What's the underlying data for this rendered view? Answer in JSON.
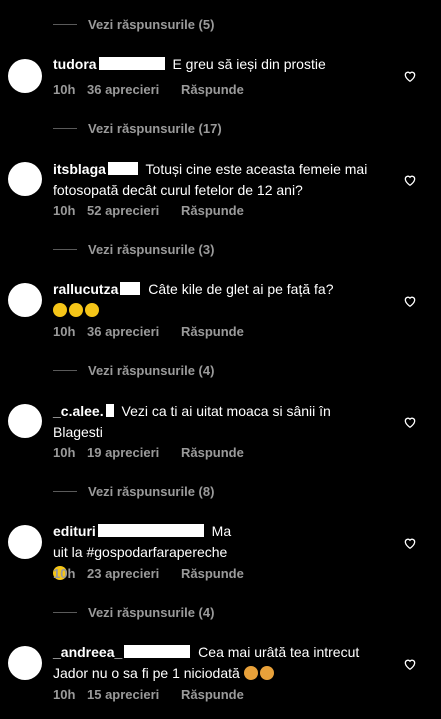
{
  "comments": [
    {
      "username": "tudora",
      "redact_w": 66,
      "text": "E greu să ieși din prostie",
      "time": "10h",
      "likes": "36 aprecieri",
      "reply": "Răspunde",
      "replies_label": "Vezi răspunsurile (17)"
    },
    {
      "username": "itsblaga",
      "redact_w": 30,
      "text": "Totuși cine este aceasta femeie mai fotosopată decât curul fetelor de 12 ani?",
      "time": "10h",
      "likes": "52 aprecieri",
      "reply": "Răspunde",
      "replies_label": "Vezi răspunsurile (3)"
    },
    {
      "username": "rallucutza",
      "redact_w": 20,
      "text": "Câte kile de glet ai pe față fa?",
      "emojis": [
        "laughing-tears",
        "laughing-tears",
        "laughing-tears"
      ],
      "time": "10h",
      "likes": "36 aprecieri",
      "reply": "Răspunde",
      "replies_label": "Vezi răspunsurile (4)"
    },
    {
      "username": "_c.alee.",
      "redact_w": 8,
      "text": "Vezi ca ti ai uitat moaca si sânii în Blagesti",
      "time": "10h",
      "likes": "19 aprecieri",
      "reply": "Răspunde",
      "replies_label": "Vezi răspunsurile (8)"
    },
    {
      "username": "edituri",
      "redact_w": 106,
      "text": "Ma uit la #gospodarfarapereche",
      "emojis": [
        "laughing-tears"
      ],
      "time": "10h",
      "likes": "23 aprecieri",
      "reply": "Răspunde",
      "replies_label": "Vezi răspunsurile (4)"
    },
    {
      "username": "_andreea_",
      "redact_w": 66,
      "text": "Cea mai urâtă tea intrecut Jador nu o sa fi pe 1 niciodată",
      "emojis": [
        "facepalm",
        "facepalm"
      ],
      "time": "10h",
      "likes": "15 aprecieri",
      "reply": "Răspunde"
    }
  ],
  "top_replies_label": "Vezi răspunsurile (5)",
  "icons": {
    "like": "heart-outline-icon"
  },
  "colors": {
    "bg": "#000000",
    "text": "#ffffff",
    "muted": "#9a9a9a"
  }
}
